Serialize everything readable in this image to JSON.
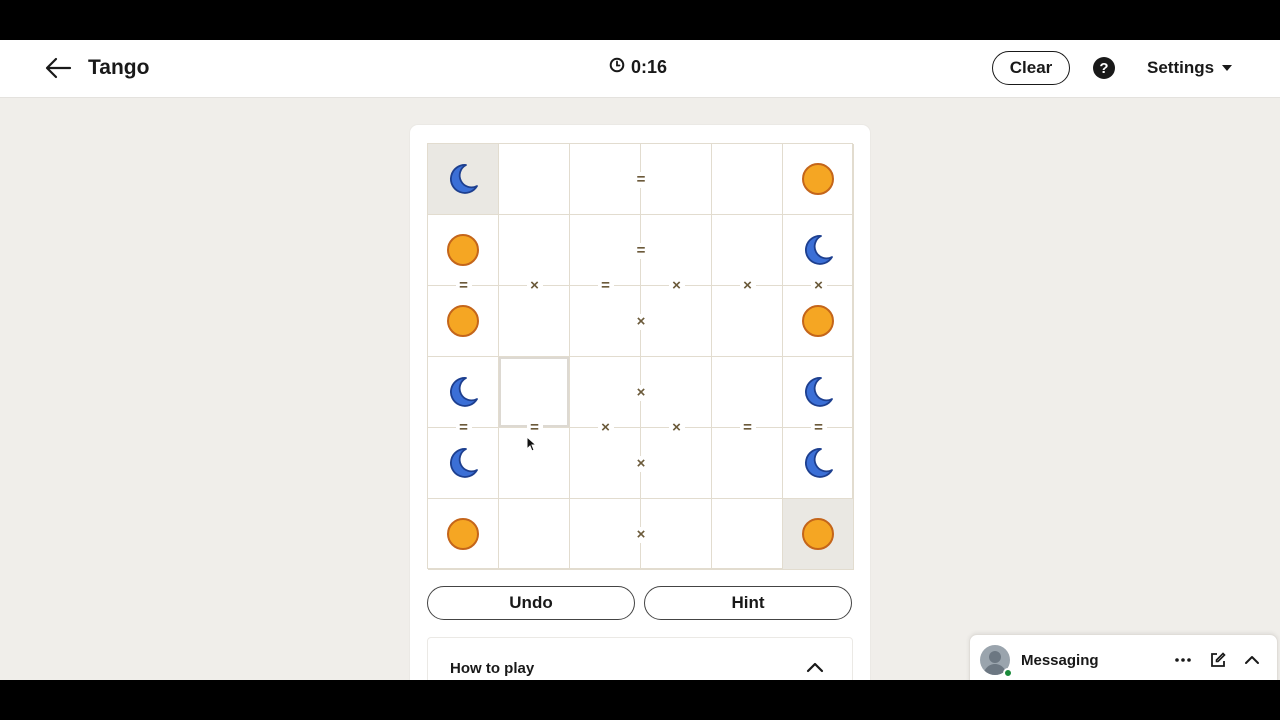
{
  "header": {
    "title": "Tango",
    "timer": "0:16",
    "clear_label": "Clear",
    "help_label": "?",
    "settings_label": "Settings"
  },
  "board": {
    "size": 6,
    "cells": [
      [
        "moon",
        "",
        "",
        "",
        "",
        "sun"
      ],
      [
        "sun",
        "",
        "",
        "",
        "",
        "moon"
      ],
      [
        "sun",
        "",
        "",
        "",
        "",
        "sun"
      ],
      [
        "moon",
        "",
        "",
        "",
        "",
        "moon"
      ],
      [
        "moon",
        "",
        "",
        "",
        "",
        "moon"
      ],
      [
        "sun",
        "",
        "",
        "",
        "",
        "sun"
      ]
    ],
    "locked": [
      [
        0,
        0
      ],
      [
        5,
        5
      ]
    ],
    "hovered": [
      3,
      1
    ],
    "h_constraints": [
      {
        "row": 0,
        "between": [
          2,
          3
        ],
        "symbol": "="
      },
      {
        "row": 1,
        "between": [
          2,
          3
        ],
        "symbol": "="
      },
      {
        "row": 2,
        "between": [
          2,
          3
        ],
        "symbol": "×"
      },
      {
        "row": 3,
        "between": [
          2,
          3
        ],
        "symbol": "×"
      },
      {
        "row": 4,
        "between": [
          2,
          3
        ],
        "symbol": "×"
      },
      {
        "row": 5,
        "between": [
          2,
          3
        ],
        "symbol": "×"
      }
    ],
    "v_constraints": [
      {
        "col": 0,
        "between": [
          1,
          2
        ],
        "symbol": "="
      },
      {
        "col": 1,
        "between": [
          1,
          2
        ],
        "symbol": "×"
      },
      {
        "col": 2,
        "between": [
          1,
          2
        ],
        "symbol": "="
      },
      {
        "col": 3,
        "between": [
          1,
          2
        ],
        "symbol": "×"
      },
      {
        "col": 4,
        "between": [
          1,
          2
        ],
        "symbol": "×"
      },
      {
        "col": 5,
        "between": [
          1,
          2
        ],
        "symbol": "×"
      },
      {
        "col": 0,
        "between": [
          3,
          4
        ],
        "symbol": "="
      },
      {
        "col": 1,
        "between": [
          3,
          4
        ],
        "symbol": "="
      },
      {
        "col": 2,
        "between": [
          3,
          4
        ],
        "symbol": "×"
      },
      {
        "col": 3,
        "between": [
          3,
          4
        ],
        "symbol": "×"
      },
      {
        "col": 4,
        "between": [
          3,
          4
        ],
        "symbol": "="
      },
      {
        "col": 5,
        "between": [
          3,
          4
        ],
        "symbol": "="
      }
    ]
  },
  "controls": {
    "undo_label": "Undo",
    "hint_label": "Hint"
  },
  "how_to_play": {
    "label": "How to play"
  },
  "messaging": {
    "label": "Messaging"
  },
  "icons": {
    "back": "arrow-left-icon",
    "timer": "clock-icon",
    "help": "question-circle-icon",
    "sun": "sun-icon",
    "moon": "moon-icon"
  },
  "colors": {
    "sun_fill": "#f5a623",
    "sun_stroke": "#c4651a",
    "moon_fill": "#3b6fd6",
    "moon_stroke": "#1d3f8f",
    "constraint": "#6b5a3a",
    "locked_bg": "#eae8e3"
  }
}
